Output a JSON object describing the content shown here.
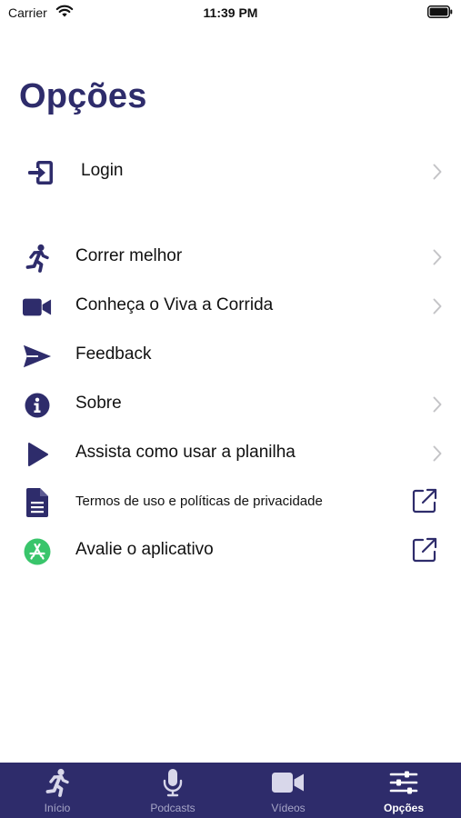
{
  "status_bar": {
    "carrier": "Carrier",
    "time": "11:39 PM"
  },
  "page": {
    "title": "Opções"
  },
  "colors": {
    "accent": "#2e2c6b",
    "chevron": "#c4c4c7",
    "appstore_green": "#39c56b"
  },
  "menu": {
    "login": {
      "label": "Login",
      "icon": "login-arrow-icon"
    },
    "items": [
      {
        "label": "Correr melhor",
        "icon": "runner-icon"
      },
      {
        "label": "Conheça o Viva a Corrida",
        "icon": "video-camera-icon"
      },
      {
        "label": "Feedback",
        "icon": "send-icon"
      },
      {
        "label": "Sobre",
        "icon": "info-icon"
      },
      {
        "label": "Assista como usar a planilha",
        "icon": "play-icon"
      },
      {
        "label": "Termos de uso e políticas de privacidade",
        "icon": "document-icon"
      },
      {
        "label": "Avalie o aplicativo",
        "icon": "app-store-icon"
      }
    ]
  },
  "tab_bar": {
    "tabs": [
      {
        "label": "Início",
        "icon": "runner-icon"
      },
      {
        "label": "Podcasts",
        "icon": "microphone-icon"
      },
      {
        "label": "Vídeos",
        "icon": "video-camera-icon"
      },
      {
        "label": "Opções",
        "icon": "sliders-icon",
        "active": true
      }
    ]
  }
}
